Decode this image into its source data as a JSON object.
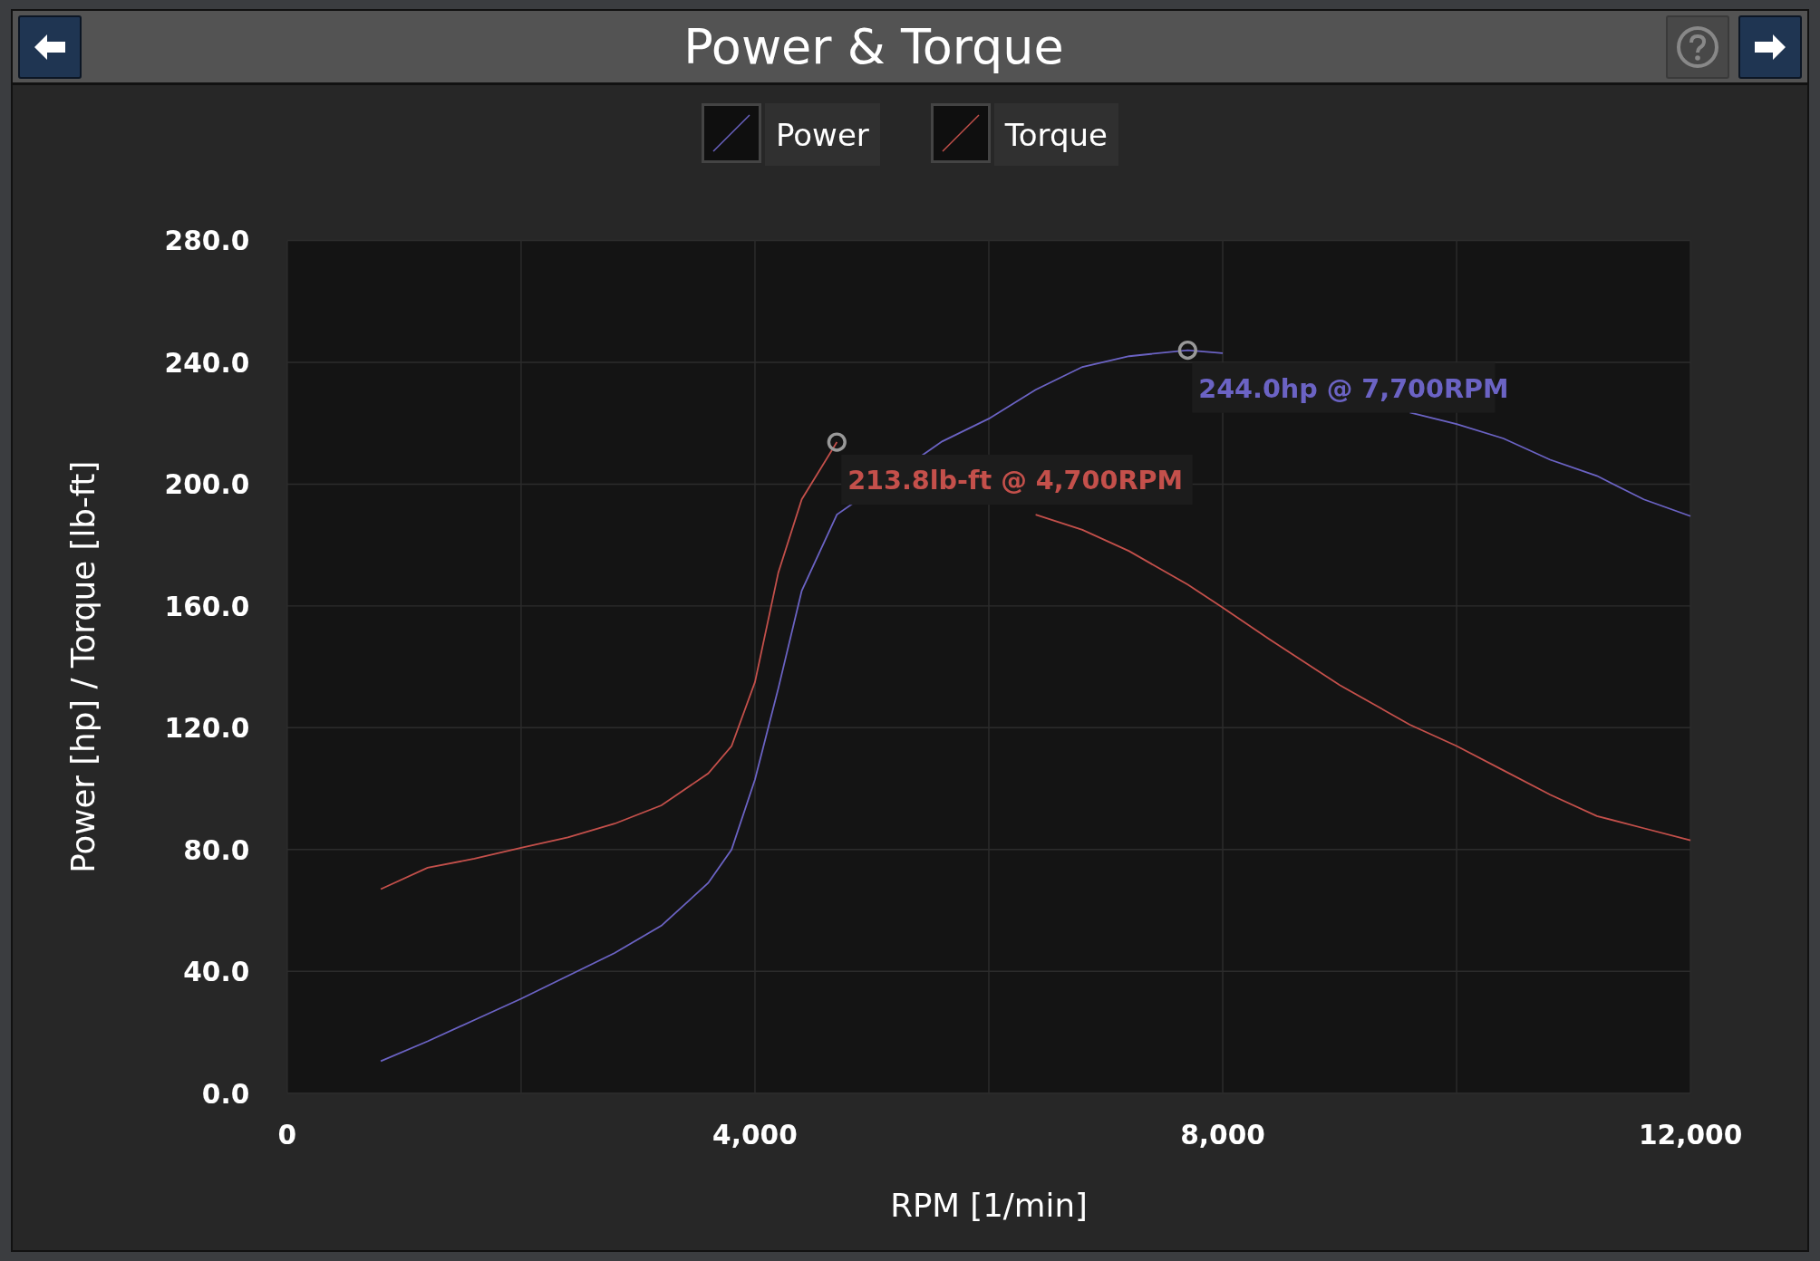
{
  "window": {
    "title": "Power & Torque"
  },
  "chart_data": {
    "type": "line",
    "xlabel": "RPM [1/min]",
    "ylabel": "Power [hp] / Torque [lb-ft]",
    "grid": true,
    "x": [
      800,
      1200,
      1600,
      2000,
      2400,
      2800,
      3200,
      3600,
      3800,
      4000,
      4200,
      4400,
      4700,
      5600,
      6000,
      6400,
      6800,
      7200,
      7700,
      8000,
      8400,
      9000,
      9600,
      10000,
      10400,
      10800,
      11200,
      11600,
      12000
    ],
    "series": [
      {
        "name": "Power",
        "color": "#6b63c4",
        "values": [
          10.5,
          17,
          24,
          31,
          38.5,
          46,
          55,
          69,
          80,
          103,
          133,
          165,
          190,
          214,
          221.5,
          231,
          238.5,
          242,
          244,
          243,
          null,
          null,
          223.5,
          219.7,
          215,
          208,
          202.7,
          195,
          189.5
        ]
      },
      {
        "name": "Torque",
        "color": "#c4504b",
        "values": [
          67,
          74,
          77,
          80.6,
          84,
          88.5,
          94.5,
          105,
          114,
          135,
          171,
          195,
          213.8,
          null,
          null,
          190,
          185,
          178,
          167,
          159.4,
          149,
          134,
          121,
          114,
          106,
          98,
          91,
          87,
          83
        ]
      }
    ],
    "xlim": [
      0,
      12000
    ],
    "ylim": [
      0,
      280
    ],
    "xticks": [
      {
        "value": 0,
        "label": "0"
      },
      {
        "value": 4000,
        "label": "4,000"
      },
      {
        "value": 8000,
        "label": "8,000"
      },
      {
        "value": 12000,
        "label": "12,000"
      }
    ],
    "yticks": [
      {
        "value": 0,
        "label": "0.0"
      },
      {
        "value": 40,
        "label": "40.0"
      },
      {
        "value": 80,
        "label": "80.0"
      },
      {
        "value": 120,
        "label": "120.0"
      },
      {
        "value": 160,
        "label": "160.0"
      },
      {
        "value": 200,
        "label": "200.0"
      },
      {
        "value": 240,
        "label": "240.0"
      },
      {
        "value": 280,
        "label": "280.0"
      }
    ],
    "annotations": [
      {
        "x": 7700,
        "y": 244,
        "text": "244.0hp @ 7,700RPM"
      },
      {
        "x": 4700,
        "y": 213.8,
        "text": "213.8lb-ft @ 4,700RPM"
      }
    ]
  }
}
